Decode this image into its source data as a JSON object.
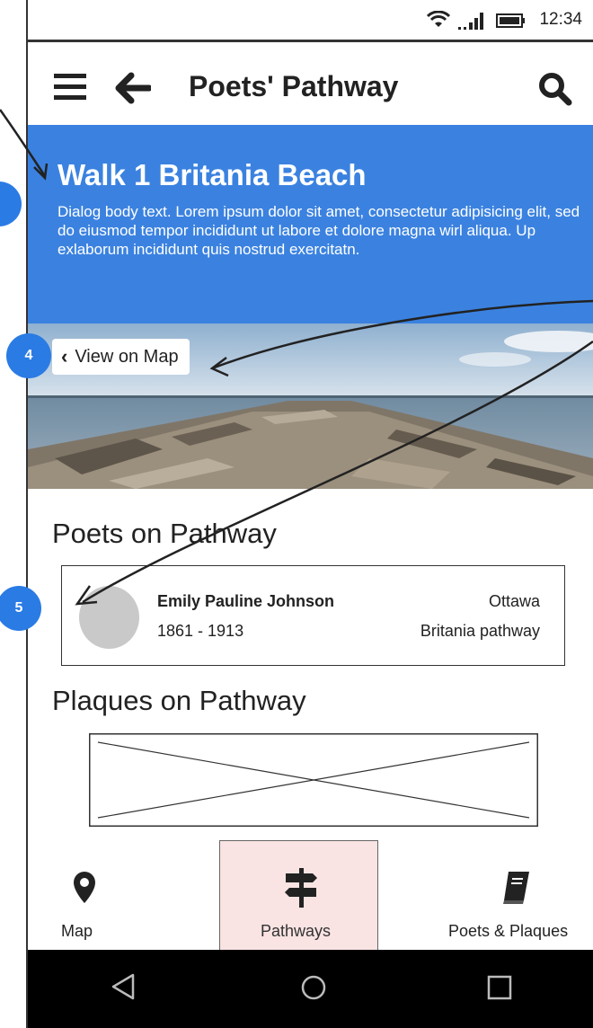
{
  "status_bar": {
    "time": "12:34",
    "icons": [
      "wifi-icon",
      "signal-icon",
      "battery-icon"
    ]
  },
  "app_bar": {
    "title": "Poets' Pathway",
    "icons": [
      "menu-icon",
      "back-arrow-icon",
      "search-icon"
    ]
  },
  "walk": {
    "title": "Walk 1 Britania Beach",
    "body": "Dialog body text.  Lorem ipsum dolor sit amet, consectetur adipisicing elit, sed do eiusmod tempor incididunt ut labore et dolore magna wirl aliqua. Up exlaborum incididunt quis nostrud exercitatn."
  },
  "hero": {
    "view_on_map_label": "View on Map"
  },
  "poets_section": {
    "heading": "Poets on Pathway",
    "poets": [
      {
        "name": "Emily Pauline Johnson",
        "years": "1861 - 1913",
        "city": "Ottawa",
        "pathway": "Britania pathway"
      }
    ]
  },
  "plaques_section": {
    "heading": "Plaques on Pathway"
  },
  "bottom_nav": {
    "items": [
      {
        "label": "Map",
        "icon": "map-pin-icon"
      },
      {
        "label": "Pathways",
        "icon": "signpost-icon",
        "selected": true
      },
      {
        "label": "Poets & Plaques",
        "icon": "book-icon"
      }
    ]
  },
  "annotations": {
    "badges": [
      "4",
      "5"
    ]
  },
  "colors": {
    "accent": "#3b82e0",
    "badge": "#2a7be4",
    "selected_tab": "#f9e3e3"
  }
}
